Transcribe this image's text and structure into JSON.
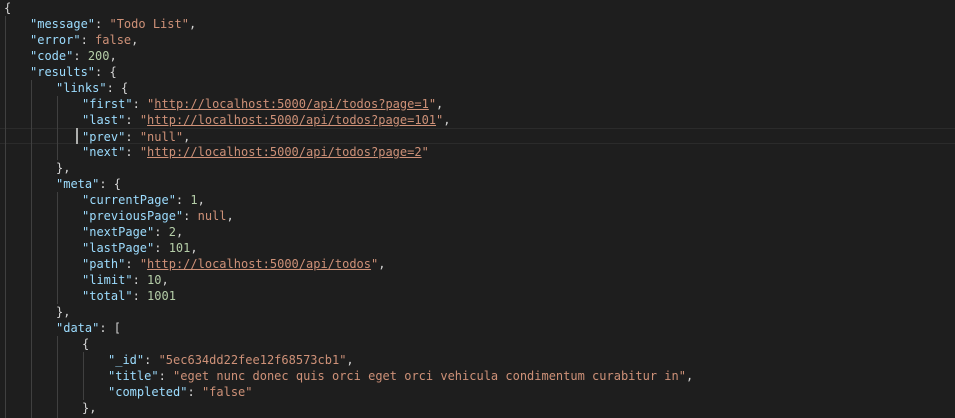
{
  "editor": {
    "active_line": 8,
    "lines": [
      {
        "indent": 0,
        "t": [
          {
            "c": "p",
            "v": "{"
          }
        ]
      },
      {
        "indent": 1,
        "t": [
          {
            "c": "k",
            "v": "\"message\""
          },
          {
            "c": "p",
            "v": ": "
          },
          {
            "c": "s",
            "v": "\"Todo List\""
          },
          {
            "c": "p",
            "v": ","
          }
        ]
      },
      {
        "indent": 1,
        "t": [
          {
            "c": "k",
            "v": "\"error\""
          },
          {
            "c": "p",
            "v": ": "
          },
          {
            "c": "b",
            "v": "false"
          },
          {
            "c": "p",
            "v": ","
          }
        ]
      },
      {
        "indent": 1,
        "t": [
          {
            "c": "k",
            "v": "\"code\""
          },
          {
            "c": "p",
            "v": ": "
          },
          {
            "c": "n",
            "v": "200"
          },
          {
            "c": "p",
            "v": ","
          }
        ]
      },
      {
        "indent": 1,
        "t": [
          {
            "c": "k",
            "v": "\"results\""
          },
          {
            "c": "p",
            "v": ": {"
          }
        ]
      },
      {
        "indent": 2,
        "t": [
          {
            "c": "k",
            "v": "\"links\""
          },
          {
            "c": "p",
            "v": ": {"
          }
        ]
      },
      {
        "indent": 3,
        "t": [
          {
            "c": "k",
            "v": "\"first\""
          },
          {
            "c": "p",
            "v": ": "
          },
          {
            "c": "s",
            "v": "\""
          },
          {
            "c": "u",
            "v": "http://localhost:5000/api/todos?page=1"
          },
          {
            "c": "s",
            "v": "\""
          },
          {
            "c": "p",
            "v": ","
          }
        ]
      },
      {
        "indent": 3,
        "t": [
          {
            "c": "k",
            "v": "\"last\""
          },
          {
            "c": "p",
            "v": ": "
          },
          {
            "c": "s",
            "v": "\""
          },
          {
            "c": "u",
            "v": "http://localhost:5000/api/todos?page=101"
          },
          {
            "c": "s",
            "v": "\""
          },
          {
            "c": "p",
            "v": ","
          }
        ]
      },
      {
        "indent": 3,
        "t": [
          {
            "c": "k",
            "v": "\"prev\""
          },
          {
            "c": "p",
            "v": ": "
          },
          {
            "c": "s",
            "v": "\"null\""
          },
          {
            "c": "p",
            "v": ","
          }
        ]
      },
      {
        "indent": 3,
        "t": [
          {
            "c": "k",
            "v": "\"next\""
          },
          {
            "c": "p",
            "v": ": "
          },
          {
            "c": "s",
            "v": "\""
          },
          {
            "c": "u",
            "v": "http://localhost:5000/api/todos?page=2"
          },
          {
            "c": "s",
            "v": "\""
          }
        ]
      },
      {
        "indent": 2,
        "t": [
          {
            "c": "p",
            "v": "},"
          }
        ]
      },
      {
        "indent": 2,
        "t": [
          {
            "c": "k",
            "v": "\"meta\""
          },
          {
            "c": "p",
            "v": ": {"
          }
        ]
      },
      {
        "indent": 3,
        "t": [
          {
            "c": "k",
            "v": "\"currentPage\""
          },
          {
            "c": "p",
            "v": ": "
          },
          {
            "c": "n",
            "v": "1"
          },
          {
            "c": "p",
            "v": ","
          }
        ]
      },
      {
        "indent": 3,
        "t": [
          {
            "c": "k",
            "v": "\"previousPage\""
          },
          {
            "c": "p",
            "v": ": "
          },
          {
            "c": "b",
            "v": "null"
          },
          {
            "c": "p",
            "v": ","
          }
        ]
      },
      {
        "indent": 3,
        "t": [
          {
            "c": "k",
            "v": "\"nextPage\""
          },
          {
            "c": "p",
            "v": ": "
          },
          {
            "c": "n",
            "v": "2"
          },
          {
            "c": "p",
            "v": ","
          }
        ]
      },
      {
        "indent": 3,
        "t": [
          {
            "c": "k",
            "v": "\"lastPage\""
          },
          {
            "c": "p",
            "v": ": "
          },
          {
            "c": "n",
            "v": "101"
          },
          {
            "c": "p",
            "v": ","
          }
        ]
      },
      {
        "indent": 3,
        "t": [
          {
            "c": "k",
            "v": "\"path\""
          },
          {
            "c": "p",
            "v": ": "
          },
          {
            "c": "s",
            "v": "\""
          },
          {
            "c": "u",
            "v": "http://localhost:5000/api/todos"
          },
          {
            "c": "s",
            "v": "\""
          },
          {
            "c": "p",
            "v": ","
          }
        ]
      },
      {
        "indent": 3,
        "t": [
          {
            "c": "k",
            "v": "\"limit\""
          },
          {
            "c": "p",
            "v": ": "
          },
          {
            "c": "n",
            "v": "10"
          },
          {
            "c": "p",
            "v": ","
          }
        ]
      },
      {
        "indent": 3,
        "t": [
          {
            "c": "k",
            "v": "\"total\""
          },
          {
            "c": "p",
            "v": ": "
          },
          {
            "c": "n",
            "v": "1001"
          }
        ]
      },
      {
        "indent": 2,
        "t": [
          {
            "c": "p",
            "v": "},"
          }
        ]
      },
      {
        "indent": 2,
        "t": [
          {
            "c": "k",
            "v": "\"data\""
          },
          {
            "c": "p",
            "v": ": ["
          }
        ]
      },
      {
        "indent": 3,
        "t": [
          {
            "c": "p",
            "v": "{"
          }
        ]
      },
      {
        "indent": 4,
        "t": [
          {
            "c": "k",
            "v": "\"_id\""
          },
          {
            "c": "p",
            "v": ": "
          },
          {
            "c": "s",
            "v": "\"5ec634dd22fee12f68573cb1\""
          },
          {
            "c": "p",
            "v": ","
          }
        ]
      },
      {
        "indent": 4,
        "t": [
          {
            "c": "k",
            "v": "\"title\""
          },
          {
            "c": "p",
            "v": ": "
          },
          {
            "c": "s",
            "v": "\"eget nunc donec quis orci eget orci vehicula condimentum curabitur in\""
          },
          {
            "c": "p",
            "v": ","
          }
        ]
      },
      {
        "indent": 4,
        "t": [
          {
            "c": "k",
            "v": "\"completed\""
          },
          {
            "c": "p",
            "v": ": "
          },
          {
            "c": "s",
            "v": "\"false\""
          }
        ]
      },
      {
        "indent": 3,
        "t": [
          {
            "c": "p",
            "v": "},"
          }
        ]
      },
      {
        "indent": 3,
        "t": []
      }
    ]
  },
  "colors": {
    "background": "#1e1e1e",
    "key": "#9cdcfe",
    "string": "#ce9178",
    "number": "#b5cea8",
    "punctuation": "#d4d4d4"
  }
}
